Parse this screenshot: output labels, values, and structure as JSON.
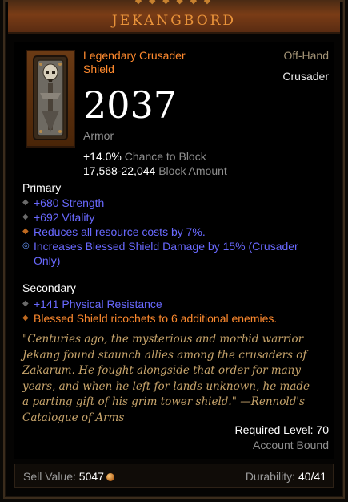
{
  "header": {
    "name": "JEKANGBORD"
  },
  "item": {
    "name": "Legendary Crusader Shield",
    "slot": "Off-Hand",
    "class": "Crusader",
    "armor_value": "2037",
    "armor_label": "Armor",
    "block_chance_value": "+14.0%",
    "block_chance_label": "Chance to Block",
    "block_amount_value": "17,568-22,044",
    "block_amount_label": "Block Amount"
  },
  "primary": {
    "title": "Primary",
    "affixes": [
      {
        "text": "+680 Strength",
        "color": "#6969ff",
        "bullet": "grey-diamond"
      },
      {
        "text": "+692 Vitality",
        "color": "#6969ff",
        "bullet": "grey-diamond"
      },
      {
        "text": "Reduces all resource costs by 7%.",
        "color": "#6969ff",
        "bullet": "orange-diamond"
      },
      {
        "text": "Increases Blessed Shield Damage by 15% (Crusader Only)",
        "color": "#6969ff",
        "bullet": "blue-swirl"
      }
    ]
  },
  "secondary": {
    "title": "Secondary",
    "affixes": [
      {
        "text": "+141 Physical Resistance",
        "color": "#6969ff",
        "bullet": "grey-diamond"
      },
      {
        "text": "Blessed Shield ricochets to 6 additional enemies.",
        "color": "#ff8a2e",
        "bullet": "orange-diamond"
      }
    ]
  },
  "flavor": "\"Centuries ago, the mysterious and morbid warrior Jekang found staunch allies among the crusaders of Zakarum. He fought alongside that order for many years, and when he left for lands unknown, he made a parting gift of his grim tower shield.\" —Rennold's Catalogue of Arms",
  "requirements": {
    "required_level": "Required Level: 70",
    "bound": "Account Bound"
  },
  "footer": {
    "sell_label": "Sell Value:",
    "sell_value": "5047",
    "durability_label": "Durability:",
    "durability_value": "40/41"
  },
  "icons": {
    "sell": "gold-coin-icon",
    "portrait": "tower-shield-skull-icon"
  },
  "colors": {
    "legendary": "#ff8a2e",
    "magic": "#6969ff",
    "header": "#7a3c16"
  }
}
